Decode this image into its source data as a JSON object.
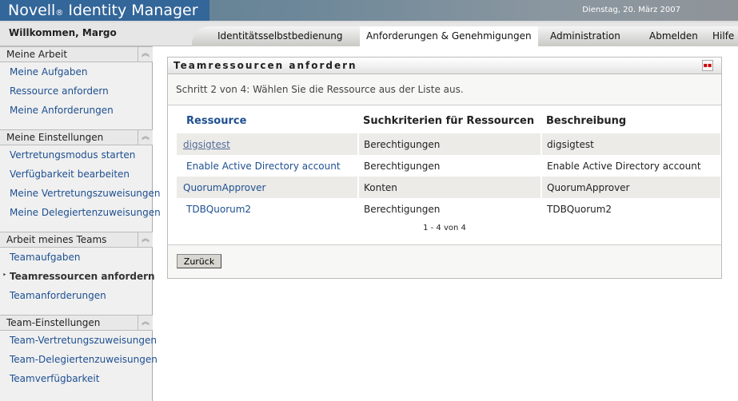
{
  "header": {
    "brand": "Novell",
    "brand_mark": "®",
    "product": "Identity Manager",
    "date": "Dienstag, 20. März 2007"
  },
  "nav": {
    "welcome": "Willkommen, Margo",
    "tabs": [
      {
        "label": "Identitätsselbstbedienung"
      },
      {
        "label": "Anforderungen & Genehmigungen",
        "active": true
      },
      {
        "label": "Administration"
      },
      {
        "label": "Abmelden"
      },
      {
        "label": "Hilfe"
      }
    ]
  },
  "sidebar": {
    "sections": [
      {
        "title": "Meine Arbeit",
        "items": [
          "Meine Aufgaben",
          "Ressource anfordern",
          "Meine Anforderungen"
        ]
      },
      {
        "title": "Meine Einstellungen",
        "items": [
          "Vertretungsmodus starten",
          "Verfügbarkeit bearbeiten",
          "Meine Vertretungszuweisungen",
          "Meine Delegiertenzuweisungen"
        ]
      },
      {
        "title": "Arbeit meines Teams",
        "items": [
          "Teamaufgaben",
          "Teamressourcen anfordern",
          "Teamanforderungen"
        ],
        "current": 1
      },
      {
        "title": "Team-Einstellungen",
        "items": [
          "Team-Vertretungszuweisungen",
          "Team-Delegiertenzuweisungen",
          "Teamverfügbarkeit"
        ]
      }
    ]
  },
  "panel": {
    "title": "Teamressourcen anfordern",
    "step": "Schritt 2 von 4: Wählen Sie die Ressource aus der Liste aus.",
    "columns": [
      "Ressource",
      "Suchkriterien für Ressourcen",
      "Beschreibung"
    ],
    "rows": [
      [
        "digsigtest",
        "Berechtigungen",
        "digsigtest"
      ],
      [
        "Enable Active Directory account",
        "Berechtigungen",
        "Enable Active Directory account"
      ],
      [
        "QuorumApprover",
        "Konten",
        "QuorumApprover"
      ],
      [
        "TDBQuorum2",
        "Berechtigungen",
        "TDBQuorum2"
      ]
    ],
    "pager": "1 - 4 von 4",
    "back_label": "Zurück"
  }
}
